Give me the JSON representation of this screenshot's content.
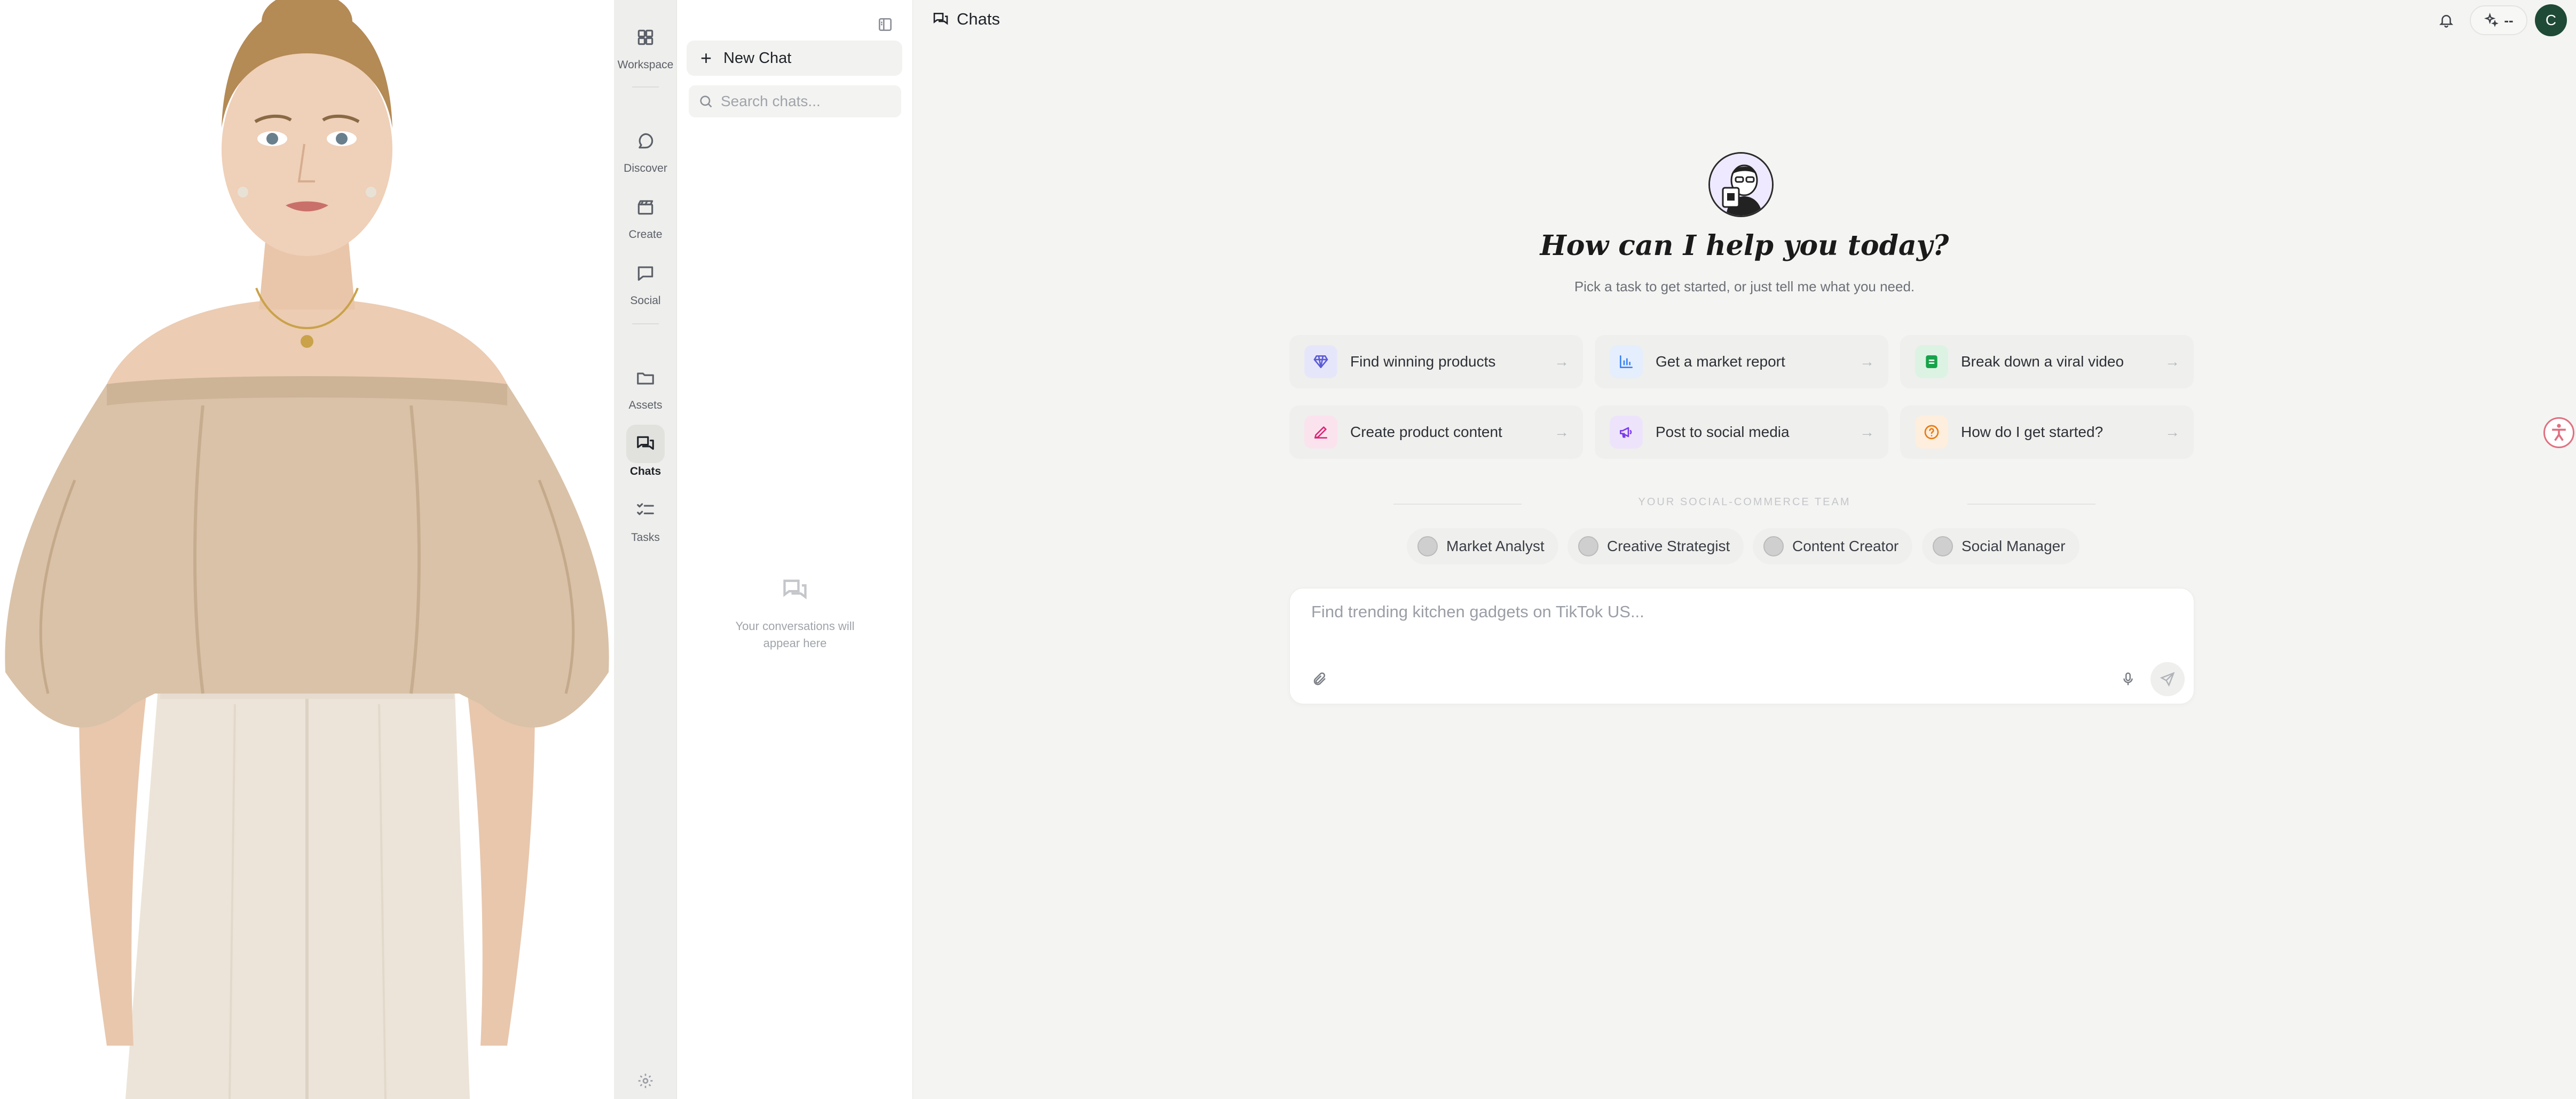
{
  "rail": {
    "items": [
      {
        "label": "Workspace",
        "icon": "grid-icon"
      },
      {
        "label": "Discover",
        "icon": "chat-bubble-icon"
      },
      {
        "label": "Create",
        "icon": "clapperboard-icon"
      },
      {
        "label": "Social",
        "icon": "message-square-icon"
      },
      {
        "label": "Assets",
        "icon": "folder-icon"
      },
      {
        "label": "Chats",
        "icon": "chats-icon",
        "active": true
      },
      {
        "label": "Tasks",
        "icon": "list-checks-icon"
      }
    ],
    "settings_icon": "gear-icon"
  },
  "sidebar": {
    "new_chat_label": "New Chat",
    "search_placeholder": "Search chats...",
    "empty_text": "Your conversations will appear here"
  },
  "header": {
    "title": "Chats",
    "credits_text": "--",
    "avatar_initial": "C"
  },
  "hero": {
    "title": "How can I help you today?",
    "subtitle": "Pick a task to get started, or just tell me what you need."
  },
  "cards": [
    {
      "label": "Find winning products",
      "icon": "diamond-icon",
      "color": "#5b5bd6",
      "bg": "#e6e6fb"
    },
    {
      "label": "Get a market report",
      "icon": "bar-chart-icon",
      "color": "#3b82f6",
      "bg": "#e4eefc"
    },
    {
      "label": "Break down a viral video",
      "icon": "film-icon",
      "color": "#16a34a",
      "bg": "#dcf3e3"
    },
    {
      "label": "Create product content",
      "icon": "pencil-icon",
      "color": "#db2777",
      "bg": "#fbe3ee"
    },
    {
      "label": "Post to social media",
      "icon": "megaphone-icon",
      "color": "#7c3aed",
      "bg": "#ede4fb"
    },
    {
      "label": "How do I get started?",
      "icon": "question-circle-icon",
      "color": "#ea7a10",
      "bg": "#fdeede"
    }
  ],
  "team": {
    "label": "YOUR SOCIAL-COMMERCE TEAM",
    "members": [
      "Market Analyst",
      "Creative Strategist",
      "Content Creator",
      "Social Manager"
    ]
  },
  "composer": {
    "placeholder": "Find trending kitchen gadgets on TikTok US..."
  }
}
